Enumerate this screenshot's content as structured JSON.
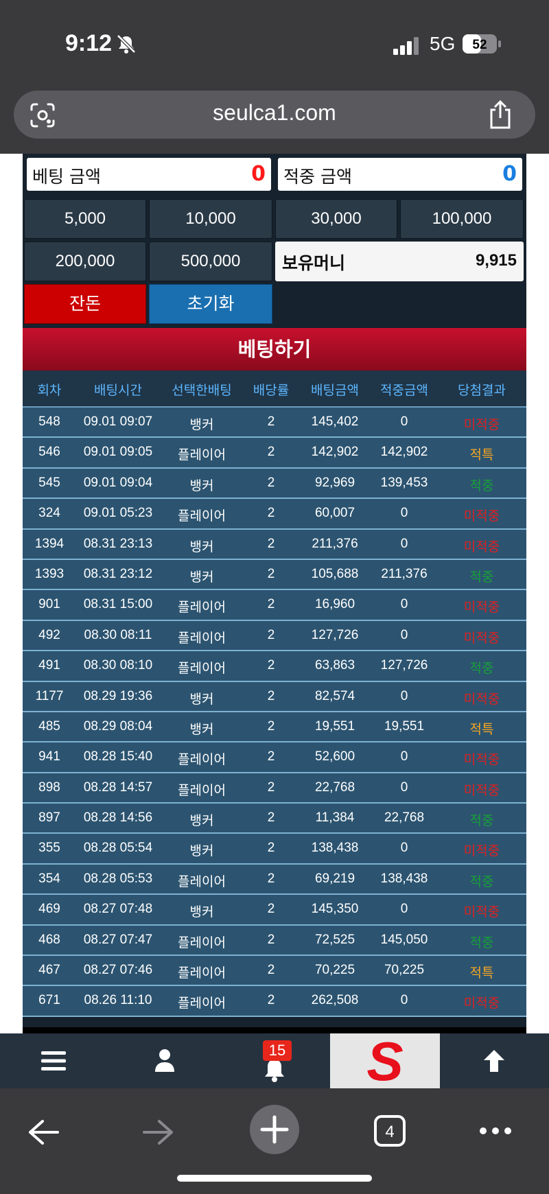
{
  "status": {
    "time": "9:12",
    "network": "5G",
    "battery": "52"
  },
  "browser": {
    "url": "seulca1.com",
    "tab_count": "4"
  },
  "summary": {
    "bet_amount_label": "베팅 금액",
    "bet_amount_value": "0",
    "win_amount_label": "적중 금액",
    "win_amount_value": "0"
  },
  "chips": [
    "5,000",
    "10,000",
    "30,000",
    "100,000",
    "200,000",
    "500,000"
  ],
  "money": {
    "label": "보유머니",
    "value": "9,915"
  },
  "buttons": {
    "change": "잔돈",
    "reset": "초기화",
    "bet": "베팅하기"
  },
  "table": {
    "headers": [
      "회차",
      "배팅시간",
      "선택한배팅",
      "배당률",
      "배팅금액",
      "적중금액",
      "당첨결과"
    ],
    "rows": [
      [
        "548",
        "09.01 09:07",
        "뱅커",
        "2",
        "145,402",
        "0",
        "미적중"
      ],
      [
        "546",
        "09.01 09:05",
        "플레이어",
        "2",
        "142,902",
        "142,902",
        "적특"
      ],
      [
        "545",
        "09.01 09:04",
        "뱅커",
        "2",
        "92,969",
        "139,453",
        "적중"
      ],
      [
        "324",
        "09.01 05:23",
        "플레이어",
        "2",
        "60,007",
        "0",
        "미적중"
      ],
      [
        "1394",
        "08.31 23:13",
        "뱅커",
        "2",
        "211,376",
        "0",
        "미적중"
      ],
      [
        "1393",
        "08.31 23:12",
        "뱅커",
        "2",
        "105,688",
        "211,376",
        "적중"
      ],
      [
        "901",
        "08.31 15:00",
        "플레이어",
        "2",
        "16,960",
        "0",
        "미적중"
      ],
      [
        "492",
        "08.30 08:11",
        "플레이어",
        "2",
        "127,726",
        "0",
        "미적중"
      ],
      [
        "491",
        "08.30 08:10",
        "플레이어",
        "2",
        "63,863",
        "127,726",
        "적중"
      ],
      [
        "1177",
        "08.29 19:36",
        "뱅커",
        "2",
        "82,574",
        "0",
        "미적중"
      ],
      [
        "485",
        "08.29 08:04",
        "뱅커",
        "2",
        "19,551",
        "19,551",
        "적특"
      ],
      [
        "941",
        "08.28 15:40",
        "플레이어",
        "2",
        "52,600",
        "0",
        "미적중"
      ],
      [
        "898",
        "08.28 14:57",
        "플레이어",
        "2",
        "22,768",
        "0",
        "미적중"
      ],
      [
        "897",
        "08.28 14:56",
        "뱅커",
        "2",
        "11,384",
        "22,768",
        "적중"
      ],
      [
        "355",
        "08.28 05:54",
        "뱅커",
        "2",
        "138,438",
        "0",
        "미적중"
      ],
      [
        "354",
        "08.28 05:53",
        "플레이어",
        "2",
        "69,219",
        "138,438",
        "적중"
      ],
      [
        "469",
        "08.27 07:48",
        "뱅커",
        "2",
        "145,350",
        "0",
        "미적중"
      ],
      [
        "468",
        "08.27 07:47",
        "플레이어",
        "2",
        "72,525",
        "145,050",
        "적중"
      ],
      [
        "467",
        "08.27 07:46",
        "플레이어",
        "2",
        "70,225",
        "70,225",
        "적특"
      ],
      [
        "671",
        "08.26 11:10",
        "플레이어",
        "2",
        "262,508",
        "0",
        "미적중"
      ]
    ]
  },
  "nav": {
    "notification_count": "15",
    "logo_letter": "S"
  },
  "colors": {
    "miss": "#e02020",
    "special": "#f5a623",
    "hit": "#18a038",
    "bet_red": "#ff1a1a",
    "win_blue": "#1a7fe0"
  },
  "icons": [
    "lens-icon",
    "share-icon",
    "menu-icon",
    "user-icon",
    "bell-icon",
    "arrow-up-icon",
    "back-icon",
    "forward-icon",
    "new-tab-icon",
    "tabs-icon",
    "more-icon"
  ]
}
